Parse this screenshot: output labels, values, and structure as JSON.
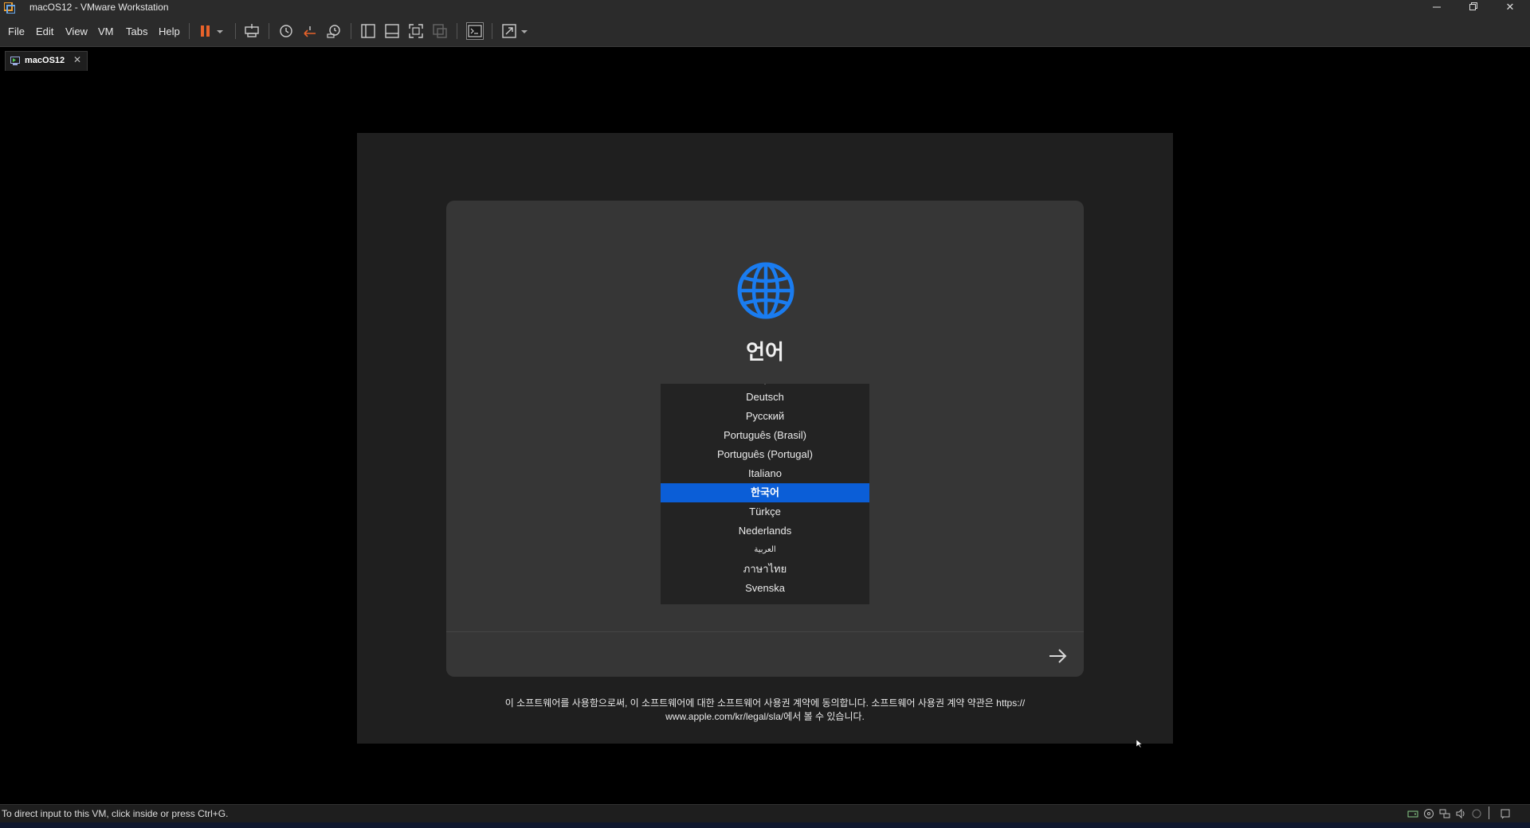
{
  "window": {
    "title": "macOS12 - VMware Workstation",
    "minimize_icon": "minimize-icon",
    "restore_icon": "restore-icon",
    "close_glyph": "✕"
  },
  "menu": {
    "items": [
      "File",
      "Edit",
      "View",
      "VM",
      "Tabs",
      "Help"
    ]
  },
  "toolbar": {
    "icons": [
      "pause-icon",
      "dropdown-icon",
      "send-ctrl-alt-del-icon",
      "snapshot-icon",
      "revert-snapshot-icon",
      "snapshot-manager-icon",
      "library-icon",
      "thumbnail-bar-icon",
      "full-screen-icon",
      "unity-icon",
      "console-view-icon",
      "stretch-guest-icon",
      "dropdown-icon"
    ],
    "accent_color": "#e8622a"
  },
  "tab": {
    "label": "macOS12",
    "close_glyph": "✕"
  },
  "setup": {
    "heading": "언어",
    "globe_color": "#1a7cf0",
    "languages": [
      {
        "label": "Deutsch",
        "selected": false
      },
      {
        "label": "Русский",
        "selected": false
      },
      {
        "label": "Português (Brasil)",
        "selected": false
      },
      {
        "label": "Português (Portugal)",
        "selected": false
      },
      {
        "label": "Italiano",
        "selected": false
      },
      {
        "label": "한국어",
        "selected": true
      },
      {
        "label": "Türkçe",
        "selected": false
      },
      {
        "label": "Nederlands",
        "selected": false
      },
      {
        "label": "العربية",
        "selected": false
      },
      {
        "label": "ภาษาไทย",
        "selected": false
      },
      {
        "label": "Svenska",
        "selected": false
      }
    ],
    "selection_color": "#0b5ed7",
    "next_icon": "arrow-right-icon",
    "legal_line1": "이 소프트웨어를 사용함으로써, 이 소프트웨어에 대한 소프트웨어 사용권 계약에 동의합니다. 소프트웨어 사용권 계약 약관은 https://",
    "legal_line2": "www.apple.com/kr/legal/sla/에서 볼 수 있습니다."
  },
  "statusbar": {
    "text": "To direct input to this VM, click inside or press Ctrl+G.",
    "icons": [
      "hard-disk-icon",
      "cd-dvd-icon",
      "network-icon",
      "sound-icon",
      "usb-icon",
      "message-icon"
    ]
  }
}
